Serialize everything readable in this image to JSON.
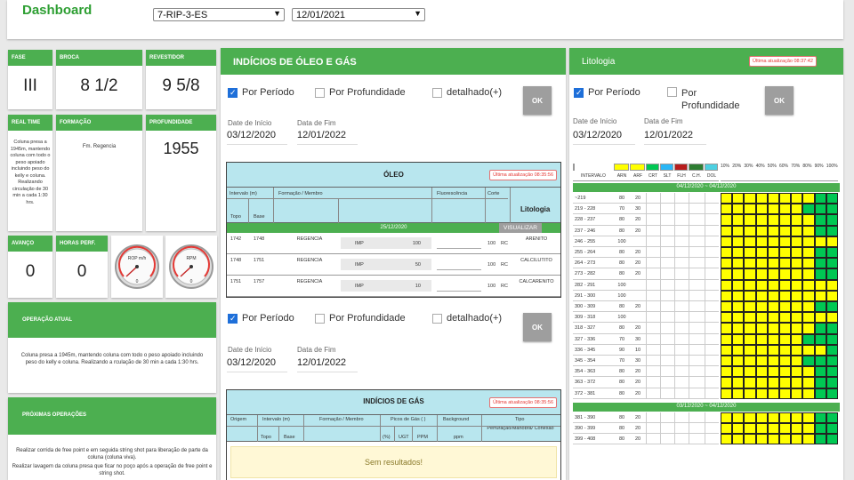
{
  "header": {
    "title": "Dashboard",
    "well_select": "7-RIP-3-ES",
    "date_select": "12/01/2021"
  },
  "cards": {
    "fase": {
      "label": "FASE",
      "value": "III"
    },
    "broca": {
      "label": "BROCA",
      "value": "8 1/2"
    },
    "revestidor": {
      "label": "REVESTIDOR",
      "value": "9 5/8"
    },
    "realtime": {
      "label": "REAL TIME",
      "text": "Coluna presa a 1945m, mantendo coluna com todo o peso apoiado incluindo peso do kelly e coluna. Realizando circulação de 30 min a cada 1:30 hrs."
    },
    "formacao": {
      "label": "FORMAÇÃO",
      "value": "Fm. Regencia"
    },
    "profundidade": {
      "label": "PROFUNDIDADE",
      "value": "1955"
    },
    "avanco": {
      "label": "AVANÇO",
      "value": "0"
    },
    "horas": {
      "label": "HORAS PERF.",
      "value": "0"
    },
    "gauge1": {
      "label": "ROP m/h",
      "value": "0"
    },
    "gauge2": {
      "label": "RPM",
      "value": "0"
    },
    "operacao": {
      "label": "OPERAÇÃO ATUAL",
      "text": "Coluna presa a 1945m, mantendo coluna com todo o peso apoiado incluindo peso do kelly e coluna. Realizando a rculação de 30 min a cada 1:30 hrs."
    },
    "proximas": {
      "label": "PRÓXIMAS OPERAÇÕES",
      "text1": "Realizar corrida de free point e em seguida string shot para liberação de parte da coluna (coluna viva).",
      "text2": "Realizar lavagem da coluna presa que ficar no poço após a operação de free point e string shot."
    }
  },
  "oleo_gas": {
    "title": "INDÍCIOS DE ÓLEO E GÁS",
    "filter1": {
      "por_periodo": "Por Período",
      "por_profundidade": "Por Profundidade",
      "detalhado": "detalhado(+)",
      "ok": "OK",
      "inicio_label": "Date de Início",
      "inicio": "03/12/2020",
      "fim_label": "Data de Fim",
      "fim": "12/01/2022"
    },
    "oleo": {
      "title": "ÓLEO",
      "badge": "Última atualização 08:35:56",
      "h_intervalo": "Intervalo (m)",
      "h_formacao": "Formação / Membro",
      "h_fluor": "Fluorescência",
      "h_corte": "Corte",
      "h_lito": "Litologia",
      "h_topo": "Topo",
      "h_base": "Base",
      "date_row": "25/12/2020",
      "visualizar": "VISUALIZAR",
      "rows": [
        {
          "topo": "1742",
          "base": "1748",
          "form": "REGENCIA",
          "tipo": "IMP",
          "val": "100",
          "corte": "100",
          "rc": "RC",
          "lito": "ARENITO"
        },
        {
          "topo": "1748",
          "base": "1751",
          "form": "REGENCIA",
          "tipo": "IMP",
          "val": "50",
          "corte": "100",
          "rc": "RC",
          "lito": "CALCILUTITO"
        },
        {
          "topo": "1751",
          "base": "1757",
          "form": "REGENCIA",
          "tipo": "IMP",
          "val": "10",
          "corte": "100",
          "rc": "RC",
          "lito": "CALCARENITO"
        }
      ]
    },
    "filter2": {
      "por_periodo": "Por Período",
      "por_profundidade": "Por Profundidade",
      "detalhado": "detalhado(+)",
      "ok": "OK",
      "inicio_label": "Date de Início",
      "inicio": "03/12/2020",
      "fim_label": "Data de Fim",
      "fim": "12/01/2022"
    },
    "gas": {
      "title": "INDÍCIOS DE GÁS",
      "badge": "Última atualização 08:35:56",
      "h_origem": "Origem",
      "h_intervalo": "Intervalo (m)",
      "h_formacao": "Formação / Membro",
      "h_picos": "Picos de Gás ( )",
      "h_background": "Background",
      "h_tipo": "Tipo",
      "h_topo": "Topo",
      "h_base": "Base",
      "h_pct": "(%)",
      "h_ugt": "UGT",
      "h_ppm": "PPM",
      "h_ppm2": "ppm",
      "h_tipo2": "Perfuração/Manobra/ Conexão",
      "empty": "Sem resultados!"
    }
  },
  "litologia": {
    "title": "Litologia",
    "badge": "Última atualização 08:37:42",
    "por_periodo": "Por Período",
    "por_profundidade": "Por Profundidade",
    "ok": "OK",
    "inicio_label": "Date de Início",
    "inicio": "03/12/2020",
    "fim_label": "Data de Fim",
    "fim": "12/01/2022",
    "pct_labels": [
      "10%",
      "20%",
      "30%",
      "40%",
      "50%",
      "60%",
      "70%",
      "80%",
      "90%",
      "100%"
    ],
    "cols": [
      "INTERVALO",
      "ARN",
      "ARF",
      "CRT",
      "SLT",
      "FLH",
      "C.H.",
      "DOL"
    ],
    "legend_colors": [
      "#ffff00",
      "#ffff00",
      "#00c853",
      "#29b6f6",
      "#b71c1c",
      "#2e7d32",
      "#4dd0e1",
      "#80deea"
    ],
    "section1": "04/12/2020 ~ 04/12/2020",
    "section2": "03/12/2020 ~ 04/12/2020",
    "rows1": [
      [
        "~219",
        "80",
        "20"
      ],
      [
        "219 - 228",
        "70",
        "30"
      ],
      [
        "228 - 237",
        "80",
        "20"
      ],
      [
        "237 - 246",
        "80",
        "20"
      ],
      [
        "246 - 255",
        "100",
        ""
      ],
      [
        "255 - 264",
        "80",
        "20"
      ],
      [
        "264 - 273",
        "80",
        "20"
      ],
      [
        "273 - 282",
        "80",
        "20"
      ],
      [
        "282 - 291",
        "100",
        ""
      ],
      [
        "291 - 300",
        "100",
        ""
      ],
      [
        "300 - 309",
        "80",
        "20"
      ],
      [
        "309 - 318",
        "100",
        ""
      ],
      [
        "318 - 327",
        "80",
        "20"
      ],
      [
        "327 - 336",
        "70",
        "30"
      ],
      [
        "336 - 345",
        "90",
        "10"
      ],
      [
        "345 - 354",
        "70",
        "30"
      ],
      [
        "354 - 363",
        "80",
        "20"
      ],
      [
        "363 - 372",
        "80",
        "20"
      ],
      [
        "372 - 381",
        "80",
        "20"
      ]
    ],
    "rows2": [
      [
        "381 - 390",
        "80",
        "20"
      ],
      [
        "390 - 399",
        "80",
        "20"
      ],
      [
        "399 - 408",
        "80",
        "20"
      ]
    ]
  }
}
